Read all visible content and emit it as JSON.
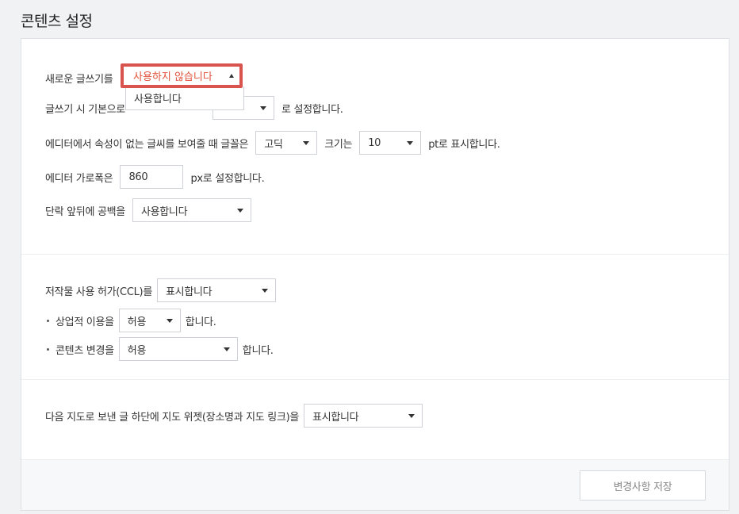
{
  "page": {
    "title": "콘텐츠 설정"
  },
  "editor": {
    "new_writer_label": "새로운 글쓰기를",
    "new_writer_selected": "사용하지 않습니다",
    "new_writer_option_1": "사용합니다",
    "default_mode_label": "글쓰기 시 기본으로",
    "default_mode_value": "",
    "default_mode_suffix": "로 설정합니다.",
    "font_label": "에디터에서 속성이 없는 글씨를 보여줄 때 글꼴은",
    "font_value": "고딕",
    "size_label": "크기는",
    "size_value": "10",
    "size_suffix": "pt로 표시합니다.",
    "width_label": "에디터 가로폭은",
    "width_value": "860",
    "width_suffix": "px로 설정합니다.",
    "spacing_label": "단락 앞뒤에 공백을",
    "spacing_value": "사용합니다"
  },
  "ccl": {
    "label": "저작물 사용 허가(CCL)를",
    "value": "표시합니다",
    "commercial_label": "상업적 이용을",
    "commercial_value": "허용",
    "commercial_suffix": "합니다.",
    "modify_label": "콘텐츠 변경을",
    "modify_value": "허용",
    "modify_suffix": "합니다."
  },
  "map": {
    "label": "다음 지도로 보낸 글 하단에 지도 위젯(장소명과 지도 링크)을",
    "value": "표시합니다"
  },
  "footer": {
    "save_label": "변경사항 저장"
  }
}
